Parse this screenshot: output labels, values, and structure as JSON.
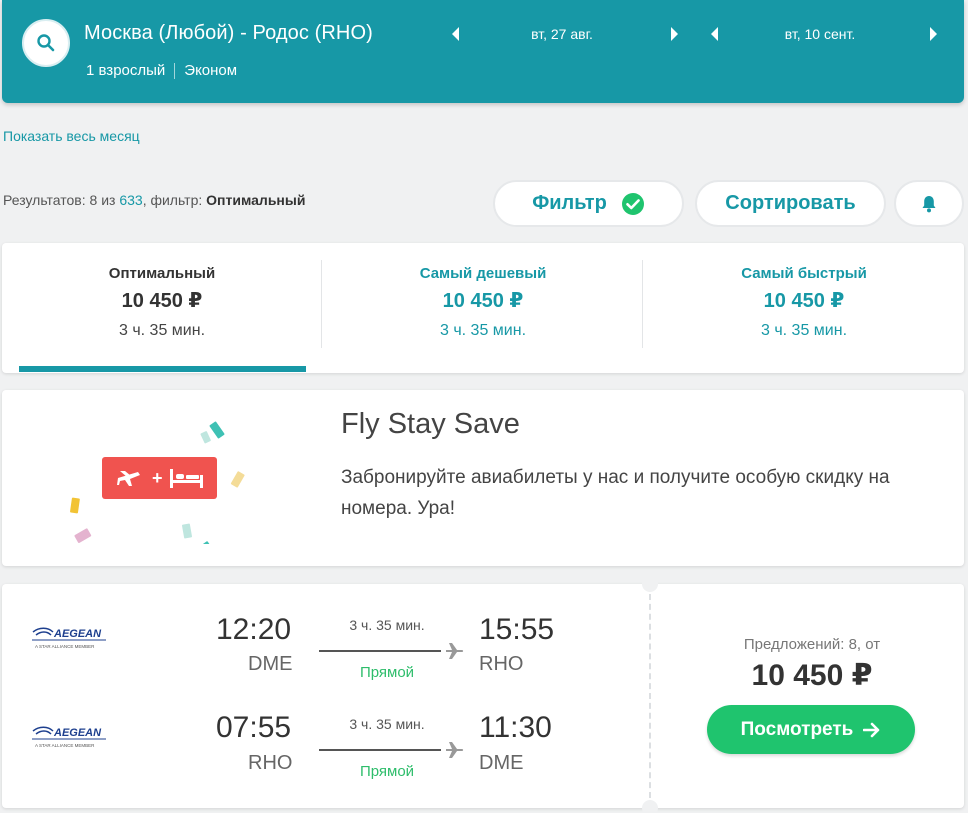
{
  "header": {
    "route": "Москва (Любой) - Родос (RHO)",
    "passengers": "1 взрослый",
    "cabin": "Эконом",
    "depart_date": "вт, 27 авг.",
    "return_date": "вт, 10 сент."
  },
  "links": {
    "whole_month": "Показать весь месяц"
  },
  "results": {
    "prefix": "Результатов: 8 из ",
    "total": "633",
    "filter_prefix": ", фильтр: ",
    "filter_value": "Оптимальный"
  },
  "buttons": {
    "filter": "Фильтр",
    "sort": "Сортировать"
  },
  "tabs": [
    {
      "label": "Оптимальный",
      "price": "10 450 ₽",
      "duration": "3 ч. 35 мин."
    },
    {
      "label": "Самый дешевый",
      "price": "10 450 ₽",
      "duration": "3 ч. 35 мин."
    },
    {
      "label": "Самый быстрый",
      "price": "10 450 ₽",
      "duration": "3 ч. 35 мин."
    }
  ],
  "promo": {
    "title": "Fly Stay Save",
    "text": "Забронируйте авиабилеты у нас и получите особую скидку на номера. Ура!"
  },
  "flight": {
    "airline": "AEGEAN",
    "airline_tagline": "A STAR ALLIANCE MEMBER",
    "outbound": {
      "dep_time": "12:20",
      "dep_code": "DME",
      "duration": "3 ч. 35 мин.",
      "stops": "Прямой",
      "arr_time": "15:55",
      "arr_code": "RHO"
    },
    "inbound": {
      "dep_time": "07:55",
      "dep_code": "RHO",
      "duration": "3 ч. 35 мин.",
      "stops": "Прямой",
      "arr_time": "11:30",
      "arr_code": "DME"
    },
    "offers": "Предложений: 8, от",
    "price": "10 450 ₽",
    "view_button": "Посмотреть"
  },
  "colors": {
    "brand": "#1798a6",
    "accent_green": "#1fc46e",
    "promo_red": "#f0534f"
  }
}
